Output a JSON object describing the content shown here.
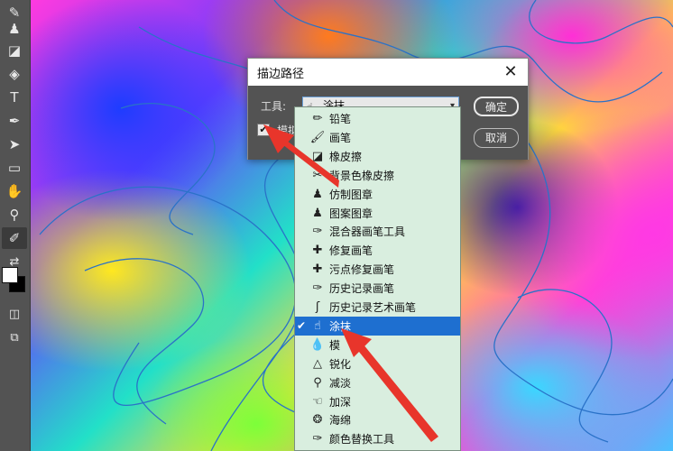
{
  "toolbar": {
    "tools": [
      {
        "name": "brush-tool",
        "icon": "brush-icon",
        "glyph": "✎"
      },
      {
        "name": "clone-stamp-tool",
        "icon": "stamp-icon",
        "glyph": "♟"
      },
      {
        "name": "eraser-tool",
        "icon": "eraser-icon",
        "glyph": "◪"
      },
      {
        "name": "paint-bucket-tool",
        "icon": "bucket-icon",
        "glyph": "◈"
      },
      {
        "name": "type-tool",
        "icon": "type-icon",
        "glyph": "T"
      },
      {
        "name": "pen-tool",
        "icon": "pen-icon",
        "glyph": "✒"
      },
      {
        "name": "path-selection-tool",
        "icon": "arrow-icon",
        "glyph": "➤"
      },
      {
        "name": "rectangle-tool",
        "icon": "rectangle-icon",
        "glyph": "▭"
      },
      {
        "name": "hand-tool",
        "icon": "hand-icon",
        "glyph": "✋"
      },
      {
        "name": "zoom-tool",
        "icon": "zoom-icon",
        "glyph": "⚲"
      },
      {
        "name": "eyedropper-tool",
        "icon": "eyedropper-icon",
        "glyph": "✐"
      }
    ],
    "foreground_color": "#ffffff",
    "background_color": "#000000"
  },
  "dialog": {
    "title": "描边路径",
    "close_glyph": "✕",
    "tool_label": "工具:",
    "tool_value": "涂抹...",
    "simulate_pressure_label": "模拟压力",
    "simulate_pressure_checked": true,
    "ok_label": "确定",
    "cancel_label": "取消"
  },
  "menu": {
    "selected_index": 12,
    "items": [
      {
        "label": "铅笔",
        "icon": "pencil-icon",
        "glyph": "✏"
      },
      {
        "label": "画笔",
        "icon": "brush-icon",
        "glyph": "🖌"
      },
      {
        "label": "橡皮擦",
        "icon": "eraser-icon",
        "glyph": "◪"
      },
      {
        "label": "背景色橡皮擦",
        "icon": "background-eraser-icon",
        "glyph": "✂"
      },
      {
        "label": "仿制图章",
        "icon": "clone-stamp-icon",
        "glyph": "♟"
      },
      {
        "label": "图案图章",
        "icon": "pattern-stamp-icon",
        "glyph": "♟"
      },
      {
        "label": "混合器画笔工具",
        "icon": "mixer-brush-icon",
        "glyph": "✑"
      },
      {
        "label": "修复画笔",
        "icon": "healing-brush-icon",
        "glyph": "✚"
      },
      {
        "label": "污点修复画笔",
        "icon": "spot-healing-icon",
        "glyph": "✚"
      },
      {
        "label": "历史记录画笔",
        "icon": "history-brush-icon",
        "glyph": "✑"
      },
      {
        "label": "历史记录艺术画笔",
        "icon": "art-history-brush-icon",
        "glyph": "ʃ"
      },
      {
        "label": "涂抹",
        "icon": "smudge-icon",
        "glyph": "☝"
      },
      {
        "label": "涂抹",
        "icon": "smudge-icon",
        "glyph": "☝"
      },
      {
        "label": "模",
        "icon": "blur-icon",
        "glyph": "💧"
      },
      {
        "label": "锐化",
        "icon": "sharpen-icon",
        "glyph": "△"
      },
      {
        "label": "减淡",
        "icon": "dodge-icon",
        "glyph": "⚲"
      },
      {
        "label": "加深",
        "icon": "burn-icon",
        "glyph": "☜"
      },
      {
        "label": "海绵",
        "icon": "sponge-icon",
        "glyph": "❂"
      },
      {
        "label": "颜色替换工具",
        "icon": "color-replacement-icon",
        "glyph": "✑"
      }
    ]
  },
  "annotation_color": "#e8352b"
}
